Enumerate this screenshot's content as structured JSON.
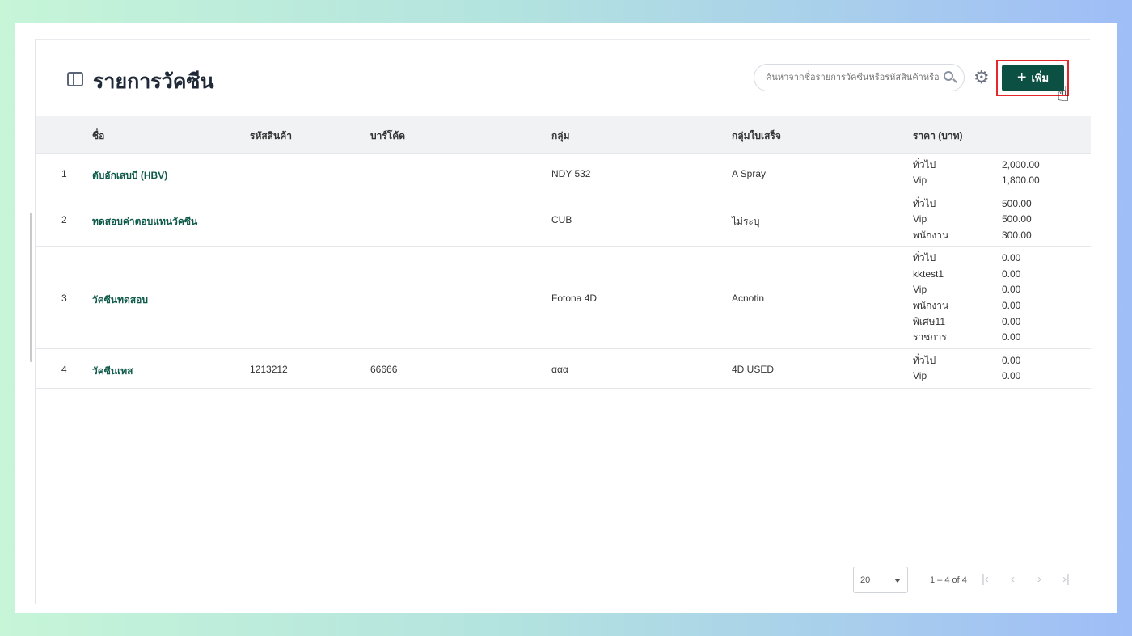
{
  "page": {
    "title": "รายการวัคซีน",
    "search_placeholder": "ค้นหาจากชื่อรายการวัคซีนหรือรหัสสินค้าหรือบาร์โค้ด",
    "add_label": "เพิ่ม"
  },
  "table": {
    "headers": [
      "ชื่อ",
      "รหัสสินค้า",
      "บาร์โค้ด",
      "กลุ่ม",
      "กลุ่มใบเสร็จ",
      "ราคา (บาท)"
    ],
    "rows": [
      {
        "no": "1",
        "name": "ตับอักเสบบี (HBV)",
        "code": "",
        "barcode": "",
        "group": "NDY 532",
        "receipt_group": "A Spray",
        "prices": [
          [
            "ทั่วไป",
            "2,000.00"
          ],
          [
            "Vip",
            "1,800.00"
          ]
        ]
      },
      {
        "no": "2",
        "name": "ทดสอบค่าตอบแทนวัคซีน",
        "code": "",
        "barcode": "",
        "group": "CUB",
        "receipt_group": "ไม่ระบุ",
        "prices": [
          [
            "ทั่วไป",
            "500.00"
          ],
          [
            "Vip",
            "500.00"
          ],
          [
            "พนักงาน",
            "300.00"
          ]
        ]
      },
      {
        "no": "3",
        "name": "วัคซีนทดสอบ",
        "code": "",
        "barcode": "",
        "group": "Fotona 4D",
        "receipt_group": "Acnotin",
        "prices": [
          [
            "ทั่วไป",
            "0.00"
          ],
          [
            "kktest1",
            "0.00"
          ],
          [
            "Vip",
            "0.00"
          ],
          [
            "พนักงาน",
            "0.00"
          ],
          [
            "พิเศษ11",
            "0.00"
          ],
          [
            "ราชการ",
            "0.00"
          ]
        ]
      },
      {
        "no": "4",
        "name": "วัคซีนเทส",
        "code": "1213212",
        "barcode": "66666",
        "group": "ααα",
        "receipt_group": "4D USED",
        "prices": [
          [
            "ทั่วไป",
            "0.00"
          ],
          [
            "Vip",
            "0.00"
          ]
        ]
      }
    ]
  },
  "pagination": {
    "page_size": "20",
    "range": "1 – 4 of 4"
  }
}
